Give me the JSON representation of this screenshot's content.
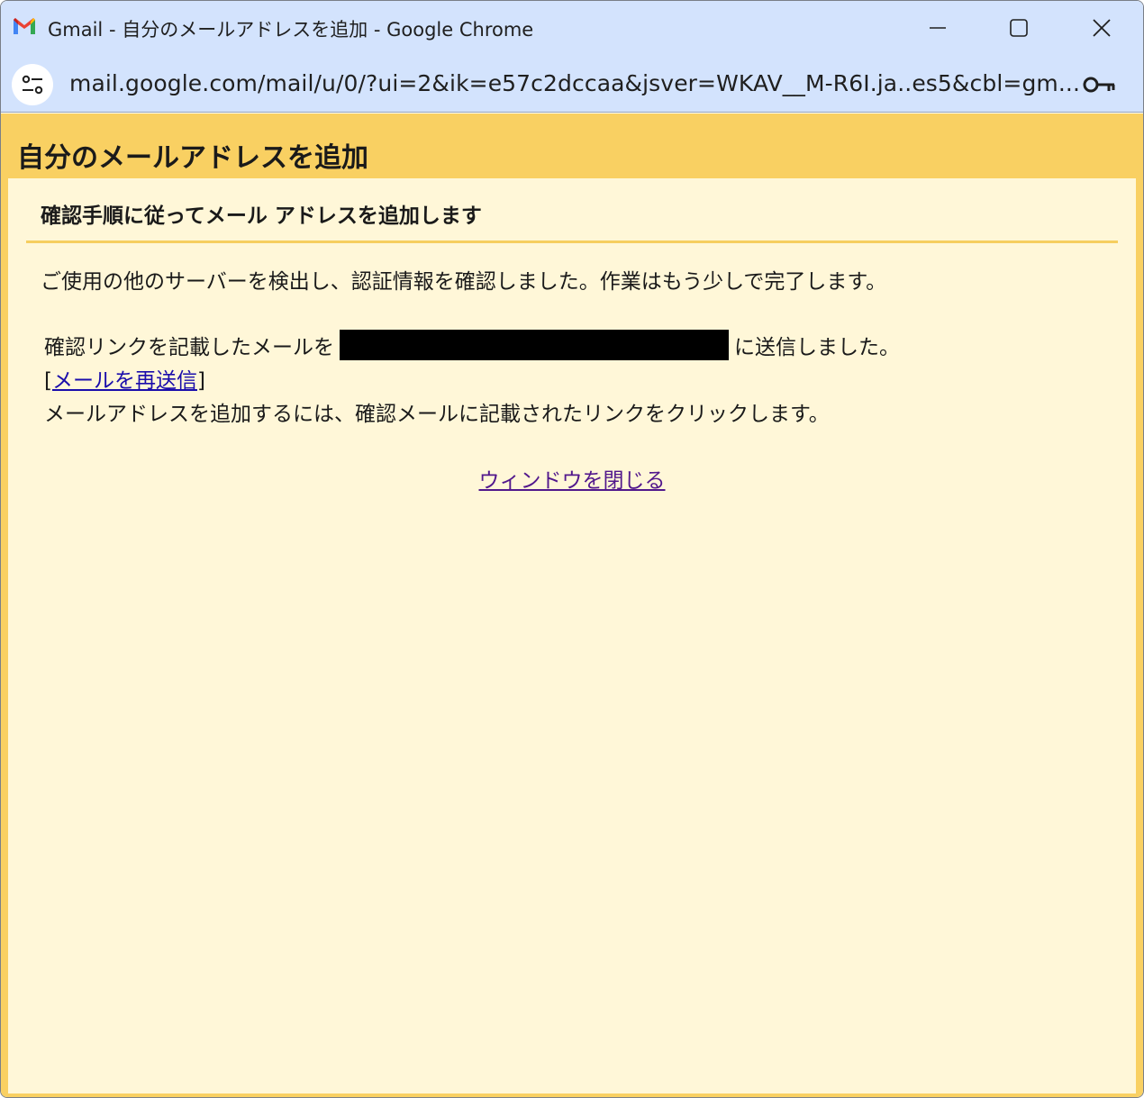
{
  "window": {
    "title": "Gmail - 自分のメールアドレスを追加 - Google Chrome",
    "icons": {
      "app": "gmail-icon",
      "minimize": "minimize-icon",
      "maximize": "maximize-icon",
      "close": "close-icon"
    }
  },
  "address_bar": {
    "url": "mail.google.com/mail/u/0/?ui=2&ik=e57c2dccaa&jsver=WKAV__M-R6I.ja..es5&cbl=gm...",
    "icons": {
      "site_info": "site-info-icon",
      "password": "key-icon"
    }
  },
  "page": {
    "title": "自分のメールアドレスを追加",
    "subtitle": "確認手順に従ってメール アドレスを追加します",
    "message1": "ご使用の他のサーバーを検出し、認証情報を確認しました。作業はもう少しで完了します。",
    "sent_prefix": "確認リンクを記載したメールを",
    "sent_suffix": "に送信しました。",
    "resend_open": "[",
    "resend_link": "メールを再送信",
    "resend_close": "]",
    "instruction": "メールアドレスを追加するには、確認メールに記載されたリンクをクリックします。",
    "close_link": "ウィンドウを閉じる"
  },
  "colors": {
    "titlebar_bg": "#d3e3fd",
    "page_border": "#f9d062",
    "panel_bg": "#fff7d8",
    "divider": "#f6ce5f",
    "link": "#1a0dab",
    "visited_link": "#52188c"
  }
}
